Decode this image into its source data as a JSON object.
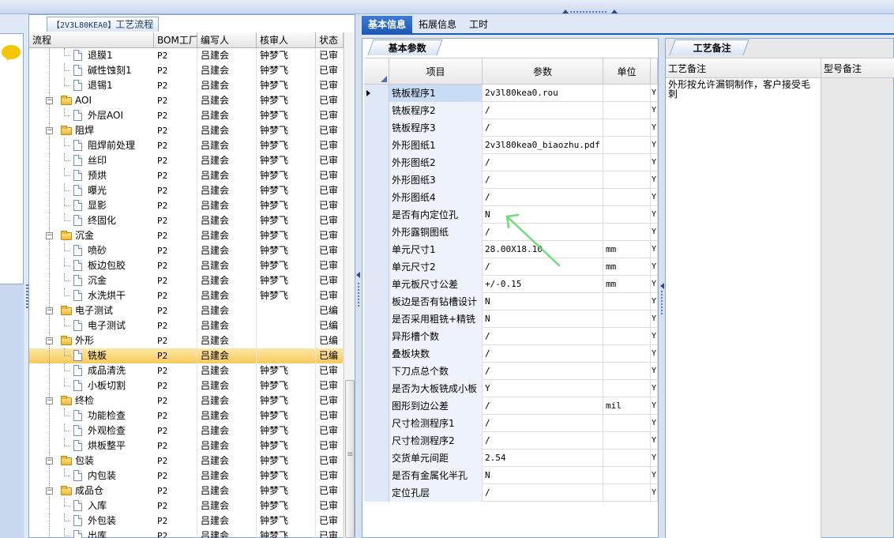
{
  "tree": {
    "title_code": "【2V3L80KEA0】",
    "title_text": "工艺流程",
    "columns": [
      "流程",
      "BOM工厂",
      "编写人",
      "核审人",
      "状态"
    ],
    "rows": [
      {
        "name": "退膜1",
        "level": 2,
        "type": "doc",
        "bom": "P2",
        "writer": "吕建会",
        "reviewer": "钟梦飞",
        "status": "已审"
      },
      {
        "name": "碱性蚀刻1",
        "level": 2,
        "type": "doc",
        "bom": "P2",
        "writer": "吕建会",
        "reviewer": "钟梦飞",
        "status": "已审"
      },
      {
        "name": "退锡1",
        "level": 2,
        "type": "doc",
        "bom": "P2",
        "writer": "吕建会",
        "reviewer": "钟梦飞",
        "status": "已审"
      },
      {
        "name": "AOI",
        "level": 1,
        "type": "folder",
        "bom": "P2",
        "writer": "吕建会",
        "reviewer": "钟梦飞",
        "status": "已审"
      },
      {
        "name": "外层AOI",
        "level": 2,
        "type": "doc",
        "bom": "P2",
        "writer": "吕建会",
        "reviewer": "钟梦飞",
        "status": "已审"
      },
      {
        "name": "阻焊",
        "level": 1,
        "type": "folder",
        "bom": "P2",
        "writer": "吕建会",
        "reviewer": "钟梦飞",
        "status": "已审"
      },
      {
        "name": "阻焊前处理",
        "level": 2,
        "type": "doc",
        "bom": "P2",
        "writer": "吕建会",
        "reviewer": "钟梦飞",
        "status": "已审"
      },
      {
        "name": "丝印",
        "level": 2,
        "type": "doc",
        "bom": "P2",
        "writer": "吕建会",
        "reviewer": "钟梦飞",
        "status": "已审"
      },
      {
        "name": "预烘",
        "level": 2,
        "type": "doc",
        "bom": "P2",
        "writer": "吕建会",
        "reviewer": "钟梦飞",
        "status": "已审"
      },
      {
        "name": "曝光",
        "level": 2,
        "type": "doc",
        "bom": "P2",
        "writer": "吕建会",
        "reviewer": "钟梦飞",
        "status": "已审"
      },
      {
        "name": "显影",
        "level": 2,
        "type": "doc",
        "bom": "P2",
        "writer": "吕建会",
        "reviewer": "钟梦飞",
        "status": "已审"
      },
      {
        "name": "终固化",
        "level": 2,
        "type": "doc",
        "bom": "P2",
        "writer": "吕建会",
        "reviewer": "钟梦飞",
        "status": "已审"
      },
      {
        "name": "沉金",
        "level": 1,
        "type": "folder",
        "bom": "P2",
        "writer": "吕建会",
        "reviewer": "钟梦飞",
        "status": "已审"
      },
      {
        "name": "喷砂",
        "level": 2,
        "type": "doc",
        "bom": "P2",
        "writer": "吕建会",
        "reviewer": "钟梦飞",
        "status": "已审"
      },
      {
        "name": "板边包胶",
        "level": 2,
        "type": "doc",
        "bom": "P2",
        "writer": "吕建会",
        "reviewer": "钟梦飞",
        "status": "已审"
      },
      {
        "name": "沉金",
        "level": 2,
        "type": "doc",
        "bom": "P2",
        "writer": "吕建会",
        "reviewer": "钟梦飞",
        "status": "已审"
      },
      {
        "name": "水洗烘干",
        "level": 2,
        "type": "doc",
        "bom": "P2",
        "writer": "吕建会",
        "reviewer": "钟梦飞",
        "status": "已审"
      },
      {
        "name": "电子测试",
        "level": 1,
        "type": "folder",
        "bom": "P2",
        "writer": "吕建会",
        "reviewer": "",
        "status": "已编"
      },
      {
        "name": "电子测试",
        "level": 2,
        "type": "doc",
        "bom": "P2",
        "writer": "吕建会",
        "reviewer": "",
        "status": "已编"
      },
      {
        "name": "外形",
        "level": 1,
        "type": "folder",
        "bom": "P2",
        "writer": "吕建会",
        "reviewer": "",
        "status": "已编"
      },
      {
        "name": "铣板",
        "level": 2,
        "type": "doc",
        "bom": "P2",
        "writer": "吕建会",
        "reviewer": "",
        "status": "已编",
        "selected": true
      },
      {
        "name": "成品清洗",
        "level": 2,
        "type": "doc",
        "bom": "P2",
        "writer": "吕建会",
        "reviewer": "钟梦飞",
        "status": "已审"
      },
      {
        "name": "小板切割",
        "level": 2,
        "type": "doc",
        "bom": "P2",
        "writer": "吕建会",
        "reviewer": "钟梦飞",
        "status": "已审"
      },
      {
        "name": "终检",
        "level": 1,
        "type": "folder",
        "bom": "P2",
        "writer": "吕建会",
        "reviewer": "钟梦飞",
        "status": "已审"
      },
      {
        "name": "功能检查",
        "level": 2,
        "type": "doc",
        "bom": "P2",
        "writer": "吕建会",
        "reviewer": "钟梦飞",
        "status": "已审"
      },
      {
        "name": "外观检查",
        "level": 2,
        "type": "doc",
        "bom": "P2",
        "writer": "吕建会",
        "reviewer": "钟梦飞",
        "status": "已审"
      },
      {
        "name": "烘板整平",
        "level": 2,
        "type": "doc",
        "bom": "P2",
        "writer": "吕建会",
        "reviewer": "钟梦飞",
        "status": "已审"
      },
      {
        "name": "包装",
        "level": 1,
        "type": "folder",
        "bom": "P2",
        "writer": "吕建会",
        "reviewer": "钟梦飞",
        "status": "已审"
      },
      {
        "name": "内包装",
        "level": 2,
        "type": "doc",
        "bom": "P2",
        "writer": "吕建会",
        "reviewer": "钟梦飞",
        "status": "已审"
      },
      {
        "name": "成品仓",
        "level": 1,
        "type": "folder",
        "bom": "P2",
        "writer": "吕建会",
        "reviewer": "钟梦飞",
        "status": "已审"
      },
      {
        "name": "入库",
        "level": 2,
        "type": "doc",
        "bom": "P2",
        "writer": "吕建会",
        "reviewer": "钟梦飞",
        "status": "已审"
      },
      {
        "name": "外包装",
        "level": 2,
        "type": "doc",
        "bom": "P2",
        "writer": "吕建会",
        "reviewer": "钟梦飞",
        "status": "已审"
      },
      {
        "name": "出库",
        "level": 2,
        "type": "doc",
        "bom": "P2",
        "writer": "吕建会",
        "reviewer": "钟梦飞",
        "status": "已审"
      }
    ]
  },
  "main_tabs": [
    "基本信息",
    "拓展信息",
    "工时"
  ],
  "params": {
    "tab_label": "基本参数",
    "columns": {
      "item": "项目",
      "param": "参数",
      "unit": "单位"
    },
    "rows": [
      {
        "item": "铣板程序1",
        "param": "2v3l80kea0.rou",
        "unit": "",
        "flag": "Y"
      },
      {
        "item": "铣板程序2",
        "param": "/",
        "unit": "",
        "flag": "Y"
      },
      {
        "item": "铣板程序3",
        "param": "/",
        "unit": "",
        "flag": "Y"
      },
      {
        "item": "外形图纸1",
        "param": "2v3l80kea0_biaozhu.pdf",
        "unit": "",
        "flag": "Y"
      },
      {
        "item": "外形图纸2",
        "param": "/",
        "unit": "",
        "flag": "Y"
      },
      {
        "item": "外形图纸3",
        "param": "/",
        "unit": "",
        "flag": "Y"
      },
      {
        "item": "外形图纸4",
        "param": "/",
        "unit": "",
        "flag": "Y"
      },
      {
        "item": "是否有内定位孔",
        "param": "N",
        "unit": "",
        "flag": "Y"
      },
      {
        "item": "外形露铜图纸",
        "param": "/",
        "unit": "",
        "flag": "Y"
      },
      {
        "item": "单元尺寸1",
        "param": "28.00X18.10",
        "unit": "mm",
        "flag": "Y"
      },
      {
        "item": "单元尺寸2",
        "param": "/",
        "unit": "mm",
        "flag": "Y"
      },
      {
        "item": "单元板尺寸公差",
        "param": "+/-0.15",
        "unit": "mm",
        "flag": "Y"
      },
      {
        "item": "板边是否有钻槽设计",
        "param": "N",
        "unit": "",
        "flag": "Y"
      },
      {
        "item": "是否采用粗铣+精铣",
        "param": "N",
        "unit": "",
        "flag": "Y"
      },
      {
        "item": "异形槽个数",
        "param": "/",
        "unit": "",
        "flag": "Y"
      },
      {
        "item": "叠板块数",
        "param": "/",
        "unit": "",
        "flag": "Y"
      },
      {
        "item": "下刀点总个数",
        "param": "/",
        "unit": "",
        "flag": "Y"
      },
      {
        "item": "是否为大板铣成小板",
        "param": "Y",
        "unit": "",
        "flag": "Y"
      },
      {
        "item": "图形到边公差",
        "param": "/",
        "unit": "mil",
        "flag": "Y"
      },
      {
        "item": "尺寸检测程序1",
        "param": "/",
        "unit": "",
        "flag": "Y"
      },
      {
        "item": "尺寸检测程序2",
        "param": "/",
        "unit": "",
        "flag": "Y"
      },
      {
        "item": "交货单元间距",
        "param": "2.54",
        "unit": "",
        "flag": "Y"
      },
      {
        "item": "是否有金属化半孔",
        "param": "N",
        "unit": "",
        "flag": "Y"
      },
      {
        "item": "定位孔层",
        "param": "/",
        "unit": "",
        "flag": "Y"
      }
    ]
  },
  "notes": {
    "tab_label": "工艺备注",
    "col_process_note": "工艺备注",
    "col_model_note": "型号备注",
    "process_note_text": "外形按允许漏铜制作，客户接受毛刺"
  },
  "colors": {
    "accent": "#1f5ab8",
    "selected_row": "#f7c95a",
    "annotation_arrow": "#6fdc7a"
  }
}
